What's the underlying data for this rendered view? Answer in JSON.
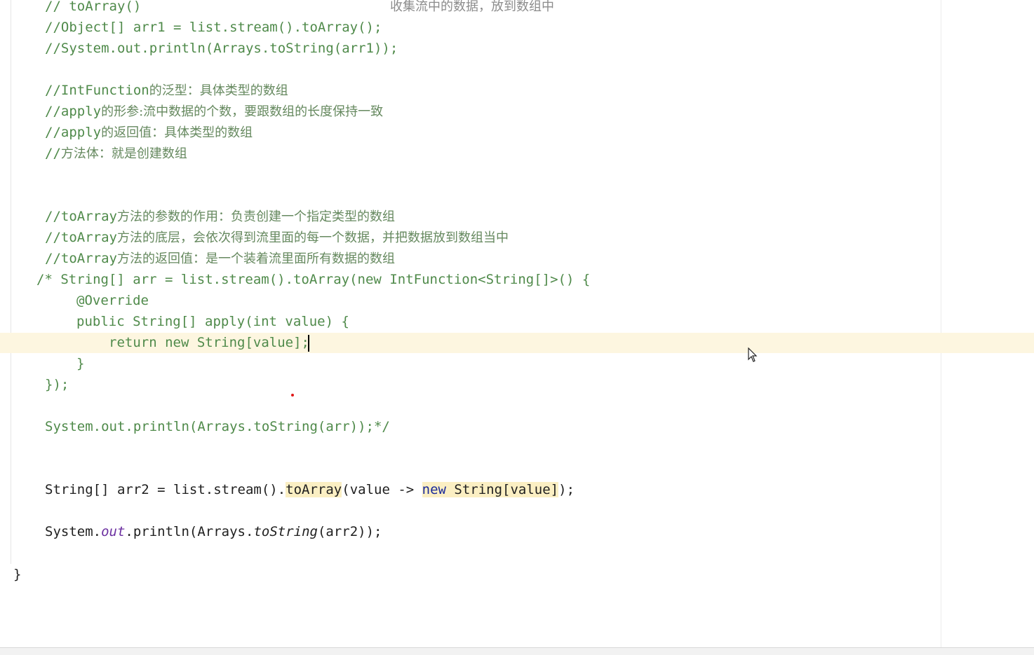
{
  "editor": {
    "header_note": "收集流中的数据，放到数组中",
    "lines": {
      "l1": "// toArray()",
      "l2": "//Object[] arr1 = list.stream().toArray();",
      "l3": "//System.out.println(Arrays.toString(arr1));",
      "c1_en": "//IntFunction",
      "c1_cn": "的泛型：具体类型的数组",
      "c2_en": "//apply",
      "c2_cn": "的形参:流中数据的个数，要跟数组的长度保持一致",
      "c3_en": "//apply",
      "c3_cn": "的返回值：具体类型的数组",
      "c4_en": "//",
      "c4_cn": "方法体：就是创建数组",
      "c5_en": "//toArray",
      "c5_cn": "方法的参数的作用：负责创建一个指定类型的数组",
      "c6_en": "//toArray",
      "c6_cn": "方法的底层，会依次得到流里面的每一个数据，并把数据放到数组当中",
      "c7_en": "//toArray",
      "c7_cn": "方法的返回值：是一个装着流里面所有数据的数组",
      "b1": "/* String[] arr = list.stream().toArray(new IntFunction<String[]>() {",
      "b2": "@Override",
      "b3": "public String[] apply(int value) {",
      "b4": "return new String[value];",
      "b5": "}",
      "b6": "});",
      "b7": "System.out.println(Arrays.toString(arr));*/",
      "s1_pre": "String[] arr2 = list.stream().",
      "s1_method": "toArray",
      "s1_mid": "(value -> ",
      "s1_new": "new",
      "s1_str": " String[value]",
      "s1_end": ");",
      "p_pre": "System.",
      "p_out": "out",
      "p_mid": ".println(Arrays.",
      "p_tostring": "toString",
      "p_end": "(arr2));",
      "close": "}"
    }
  },
  "colors": {
    "comment": "#4f8a4a",
    "caret_line": "#fdf6e0",
    "highlight": "#fbefc3",
    "keyword": "#1a2a9a",
    "field": "#6b2fa0"
  }
}
